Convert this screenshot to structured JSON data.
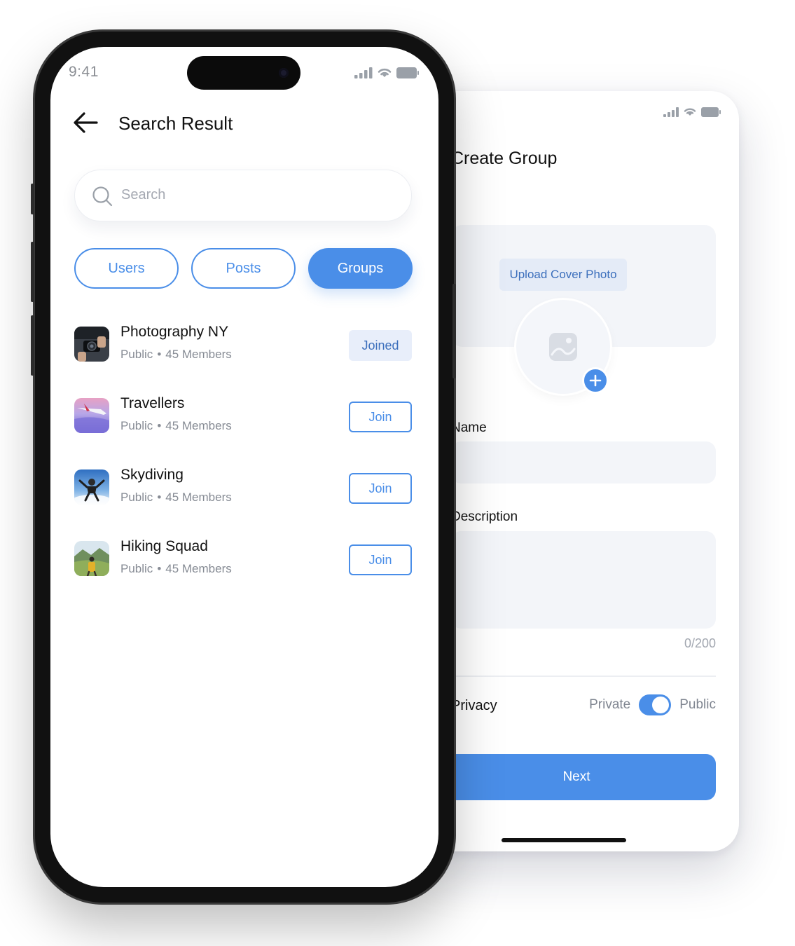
{
  "create_group": {
    "title": "Create Group",
    "upload_cover_label": "Upload Cover Photo",
    "name_label": "Name",
    "name_value": "",
    "description_label": "Description",
    "description_value": "",
    "description_counter": "0/200",
    "privacy_label": "Privacy",
    "privacy_private_label": "Private",
    "privacy_public_label": "Public",
    "privacy_is_public": true,
    "next_label": "Next"
  },
  "search_result": {
    "status_time": "9:41",
    "title": "Search Result",
    "search_placeholder": "Search",
    "tabs": [
      {
        "label": "Users",
        "active": false
      },
      {
        "label": "Posts",
        "active": false
      },
      {
        "label": "Groups",
        "active": true
      }
    ],
    "groups": [
      {
        "name": "Photography NY",
        "visibility": "Public",
        "separator": "•",
        "members": "45 Members",
        "action": "Joined"
      },
      {
        "name": "Travellers",
        "visibility": "Public",
        "separator": "•",
        "members": "45 Members",
        "action": "Join"
      },
      {
        "name": "Skydiving",
        "visibility": "Public",
        "separator": "•",
        "members": "45 Members",
        "action": "Join"
      },
      {
        "name": "Hiking Squad",
        "visibility": "Public",
        "separator": "•",
        "members": "45 Members",
        "action": "Join"
      }
    ]
  },
  "colors": {
    "accent": "#4a8ee8",
    "joined_bg": "#e8eefa",
    "field_bg": "#f3f5f9"
  }
}
